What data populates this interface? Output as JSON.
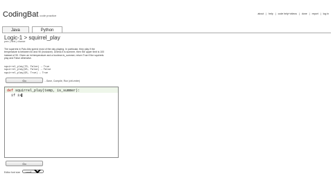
{
  "header": {
    "logo": "CodingBat",
    "logo_sub": "code practice",
    "links": [
      "about",
      "|",
      "help",
      "|",
      "code help+videos",
      "|",
      "done",
      "|",
      "report",
      "|",
      "log in"
    ]
  },
  "tabs": [
    {
      "label": "Java",
      "active": false
    },
    {
      "label": "Python",
      "active": true
    }
  ],
  "problem": {
    "title": "Logic-1 > squirrel_play",
    "prev": "prev",
    "next": "next",
    "chance": "chance",
    "description": "The squirrels in Palo Alto spend most of the day playing. In particular, they play if the temperature is between 60 and 90 (inclusive). Unless it is summer, then the upper limit is 100 instead of 90. Given an int temperature and a boolean is_summer, return True if the squirrels play and False otherwise.",
    "examples": [
      "squirrel_play(70, False) → True",
      "squirrel_play(95, False) → False",
      "squirrel_play(95, True) → True"
    ]
  },
  "editor": {
    "go_label": "Go",
    "go_note": "...Save, Compile, Run (ctrl-enter)",
    "keyword": "def",
    "signature": " squirrel_play(temp, is_summer):",
    "line2": "  if is"
  },
  "footer": {
    "go_label": "Go",
    "font_size_label": "Editor font size",
    "font_size_value": "small"
  }
}
